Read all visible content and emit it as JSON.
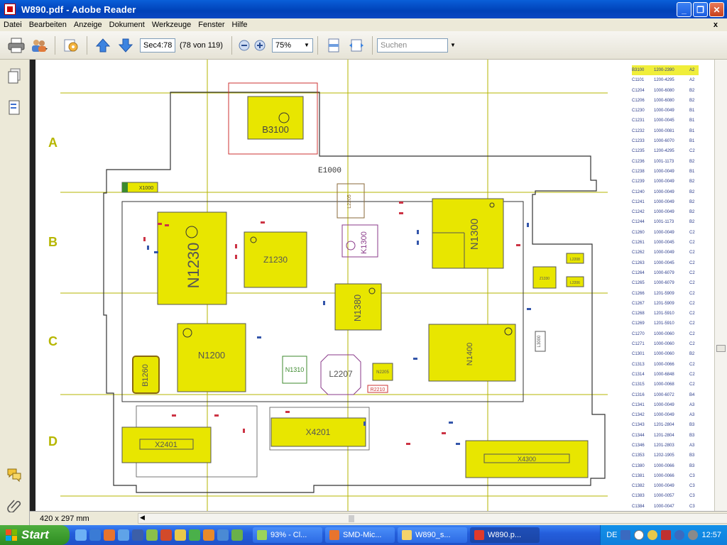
{
  "window": {
    "title": "W890.pdf - Adobe Reader"
  },
  "menu": [
    "Datei",
    "Bearbeiten",
    "Anzeige",
    "Dokument",
    "Werkzeuge",
    "Fenster",
    "Hilfe"
  ],
  "menu_close": "x",
  "toolbar": {
    "page_field": "Sec4:78",
    "page_count": "(78 von 119)",
    "zoom": "75%",
    "search_placeholder": "Suchen"
  },
  "schematic": {
    "rows": [
      "A",
      "B",
      "C",
      "D"
    ],
    "top_label": "E1000",
    "components": [
      "B3100",
      "N1230",
      "Z1230",
      "N1300",
      "N1380",
      "K1300",
      "L2207",
      "N1200",
      "N1400",
      "X4201",
      "X2401",
      "X4300",
      "B1260",
      "X1000",
      "N1310",
      "L3000",
      "L2206",
      "L2205",
      "Z1330",
      "N2205",
      "L2208",
      "R2210"
    ],
    "parts_table": [
      [
        "B3100",
        "1200-2390",
        "A2"
      ],
      [
        "C1101",
        "1200-4295",
        "A2"
      ],
      [
        "C1204",
        "1000-6080",
        "B2"
      ],
      [
        "C1206",
        "1000-6080",
        "B2"
      ],
      [
        "C1230",
        "1000-0049",
        "B1"
      ],
      [
        "C1231",
        "1000-0045",
        "B1"
      ],
      [
        "C1232",
        "1000-0081",
        "B1"
      ],
      [
        "C1233",
        "1000-6070",
        "B1"
      ],
      [
        "C1235",
        "1200-4295",
        "C2"
      ],
      [
        "C1236",
        "1001-1173",
        "B2"
      ],
      [
        "C1238",
        "1000-0049",
        "B1"
      ],
      [
        "C1239",
        "1000-0049",
        "B2"
      ],
      [
        "C1240",
        "1000-0049",
        "B2"
      ],
      [
        "C1241",
        "1000-0049",
        "B2"
      ],
      [
        "C1242",
        "1000-0049",
        "B2"
      ],
      [
        "C1244",
        "1001-1173",
        "B2"
      ],
      [
        "C1260",
        "1000-0049",
        "C2"
      ],
      [
        "C1261",
        "1000-0045",
        "C2"
      ],
      [
        "C1262",
        "1000-0049",
        "C2"
      ],
      [
        "C1263",
        "1000-0045",
        "C2"
      ],
      [
        "C1264",
        "1000-6079",
        "C2"
      ],
      [
        "C1265",
        "1000-6079",
        "C2"
      ],
      [
        "C1266",
        "1201-5909",
        "C2"
      ],
      [
        "C1267",
        "1201-5909",
        "C2"
      ],
      [
        "C1268",
        "1201-5910",
        "C2"
      ],
      [
        "C1269",
        "1201-5910",
        "C2"
      ],
      [
        "C1270",
        "1000-0060",
        "C2"
      ],
      [
        "C1271",
        "1000-0060",
        "C2"
      ],
      [
        "C1301",
        "1000-0060",
        "B2"
      ],
      [
        "C1313",
        "1000-0066",
        "C2"
      ],
      [
        "C1314",
        "1000-6848",
        "C2"
      ],
      [
        "C1315",
        "1000-0068",
        "C2"
      ],
      [
        "C1316",
        "1000-6072",
        "B4"
      ],
      [
        "C1341",
        "1000-0049",
        "A3"
      ],
      [
        "C1342",
        "1000-0049",
        "A3"
      ],
      [
        "C1343",
        "1201-2804",
        "B3"
      ],
      [
        "C1344",
        "1201-2804",
        "B3"
      ],
      [
        "C1346",
        "1201-2803",
        "A3"
      ],
      [
        "C1353",
        "1202-1905",
        "B3"
      ],
      [
        "C1380",
        "1000-0066",
        "B3"
      ],
      [
        "C1381",
        "1000-0066",
        "C3"
      ],
      [
        "C1382",
        "1000-0049",
        "C3"
      ],
      [
        "C1383",
        "1000-0057",
        "C3"
      ],
      [
        "C1384",
        "1000-0047",
        "C3"
      ]
    ]
  },
  "status": {
    "page_size": "420 x 297 mm"
  },
  "taskbar": {
    "start": "Start",
    "tasks": [
      "93% - Cl...",
      "SMD-Mic...",
      "W890_s...",
      "W890.p..."
    ],
    "lang": "DE",
    "clock": "12:57"
  },
  "colors": {
    "title_bar": "#0a5fd8",
    "component_fill": "#e8e600",
    "grid_line": "#b6b600",
    "taskbar": "#245edc",
    "start": "#3a9a2c"
  }
}
